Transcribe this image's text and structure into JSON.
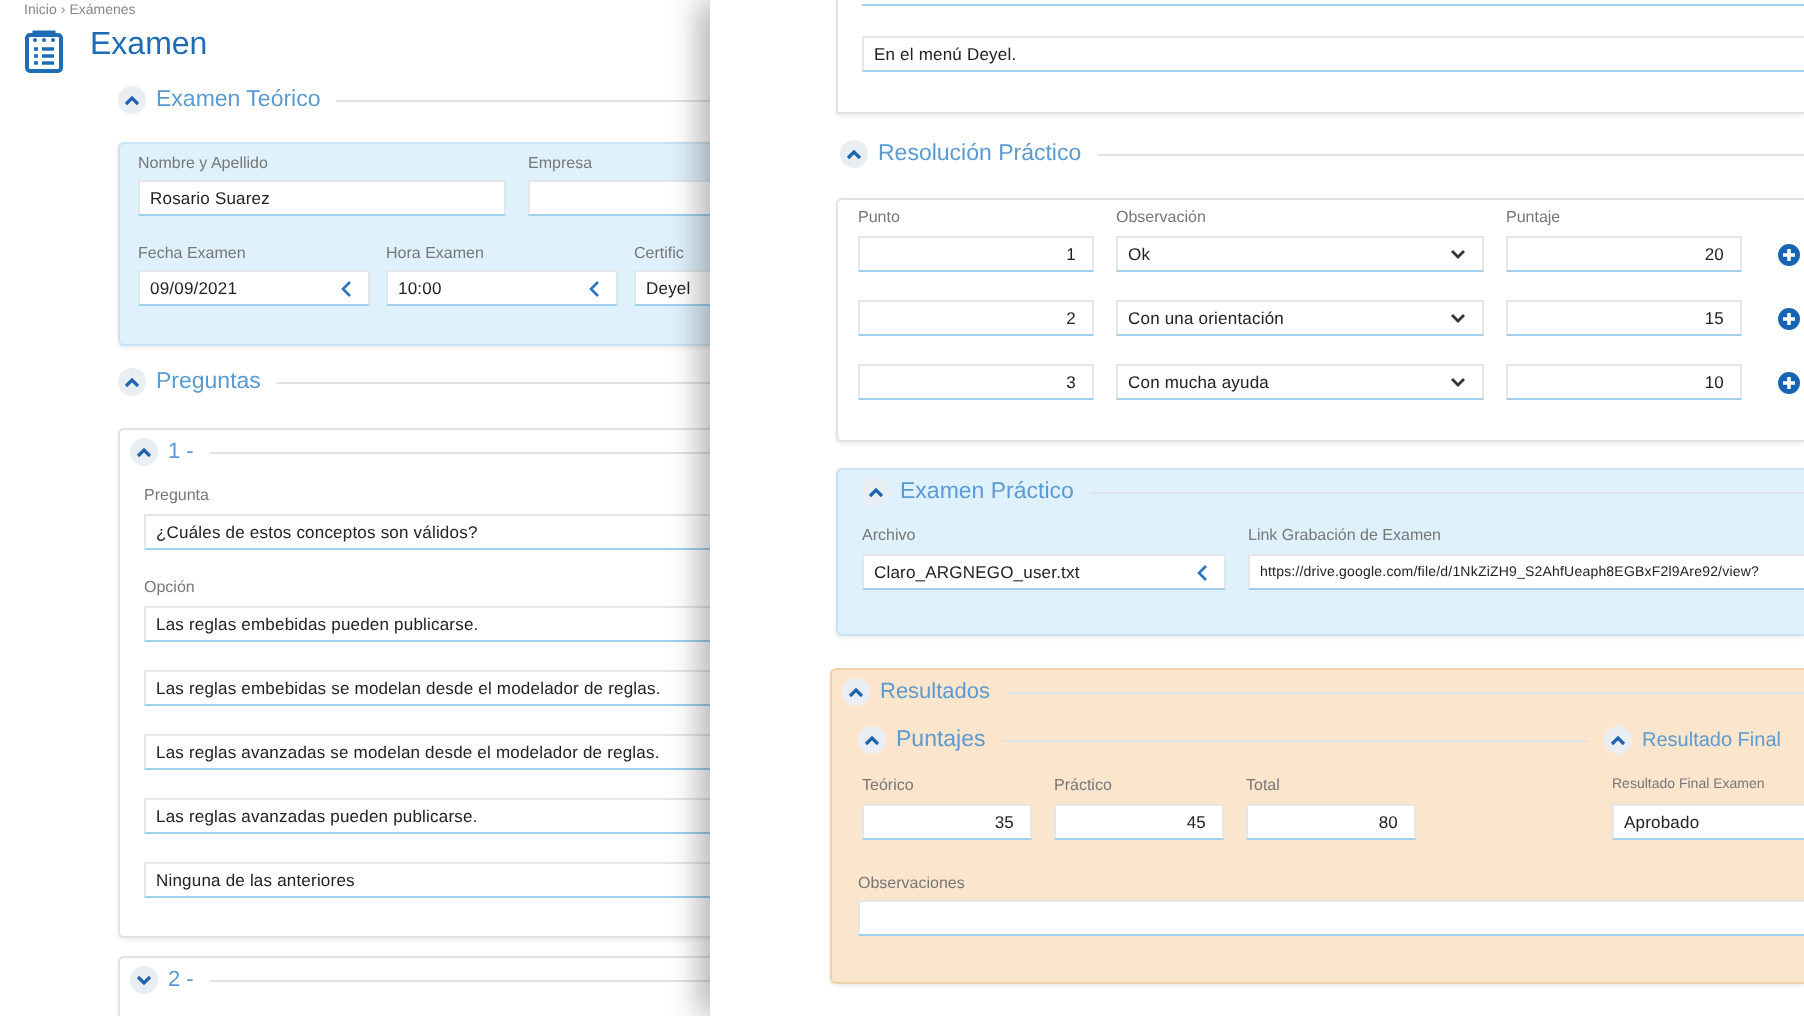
{
  "breadcrumb": {
    "items": [
      "Inicio",
      "Exámenes"
    ],
    "separator": "›"
  },
  "page_title": "Examen",
  "examen_teorico": {
    "title": "Examen Teórico",
    "expanded": true,
    "rows": [
      [
        {
          "label": "Nombre y Apellido",
          "value": "Rosario Suarez",
          "kind": "text"
        },
        {
          "label": "Empresa",
          "kind": "text"
        }
      ],
      [
        {
          "label": "Fecha Examen",
          "value": "09/09/2021",
          "kind": "date"
        },
        {
          "label": "Hora Examen",
          "value": "10:00",
          "kind": "time"
        },
        {
          "label": "Certific",
          "value": "Deyel",
          "kind": "text"
        }
      ]
    ]
  },
  "preguntas": {
    "title": "Preguntas",
    "expanded": true,
    "items": [
      {
        "number": "1 -",
        "expanded": true,
        "pregunta": {
          "label": "Pregunta",
          "value": "¿Cuáles de estos conceptos son válidos?",
          "kind": "text"
        },
        "opciones": {
          "label": "Opción",
          "values": [
            "Las reglas embebidas pueden publicarse.",
            "Las reglas embebidas se modelan desde el modelador de reglas.",
            "Las reglas avanzadas se modelan desde el modelador de reglas.",
            "Las reglas avanzadas pueden publicarse.",
            "Ninguna de las anteriores"
          ]
        }
      },
      {
        "number": "2 -",
        "expanded": false
      }
    ]
  },
  "respuesta_previa": {
    "value": "En el menú Deyel.",
    "kind": "text"
  },
  "resolucion_practico": {
    "title": "Resolución Práctico",
    "expanded": true,
    "columns": [
      "Punto",
      "Observación",
      "Puntaje"
    ],
    "rows": [
      {
        "punto": "1",
        "observacion": "Ok",
        "puntaje": "20"
      },
      {
        "punto": "2",
        "observacion": "Con una orientación",
        "puntaje": "15"
      },
      {
        "punto": "3",
        "observacion": "Con mucha ayuda",
        "puntaje": "10"
      }
    ]
  },
  "examen_practico": {
    "title": "Examen Práctico",
    "expanded": true,
    "fields": [
      {
        "label": "Archivo",
        "value": "Claro_ARGNEGO_user.txt",
        "kind": "file"
      },
      {
        "label": "Link Grabación de Examen",
        "value": "https://drive.google.com/file/d/1NkZiZH9_S2AhfUeaph8EGBxF2l9Are92/view?",
        "kind": "link"
      }
    ]
  },
  "resultados": {
    "title": "Resultados",
    "expanded": true,
    "puntajes": {
      "title": "Puntajes",
      "expanded": true,
      "fields": [
        {
          "label": "Teórico",
          "value": "35",
          "kind": "number"
        },
        {
          "label": "Práctico",
          "value": "45",
          "kind": "number"
        },
        {
          "label": "Total",
          "value": "80",
          "kind": "number"
        }
      ]
    },
    "resultado_final": {
      "title": "Resultado Final",
      "expanded": true,
      "fields": [
        {
          "label": "Resultado Final Examen",
          "value": "Aprobado",
          "kind": "text"
        }
      ]
    },
    "observaciones": {
      "label": "Observaciones",
      "kind": "text"
    }
  }
}
